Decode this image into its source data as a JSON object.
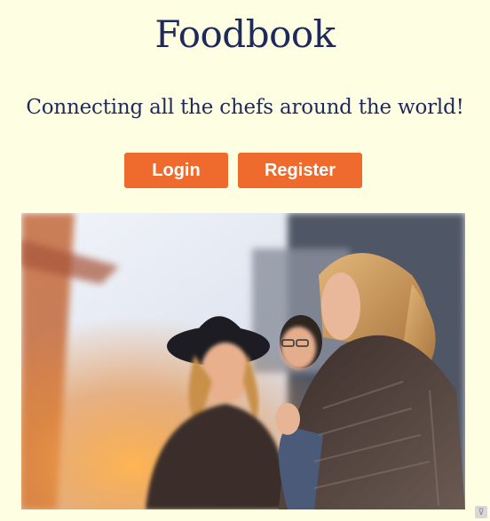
{
  "app": {
    "title": "Foodbook",
    "tagline": "Connecting all the chefs around the world!"
  },
  "buttons": {
    "login_label": "Login",
    "register_label": "Register"
  },
  "hero": {
    "description_icon": "photo-friends-laughing"
  },
  "colors": {
    "background": "#fefee2",
    "title": "#1f2a5c",
    "button": "#ee6b2d",
    "button_text": "#ffffff"
  }
}
